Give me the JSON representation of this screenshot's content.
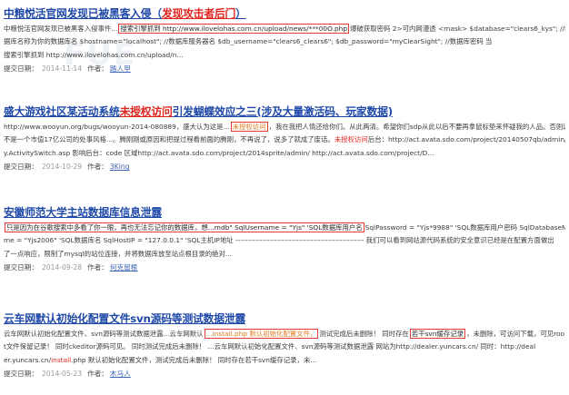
{
  "entries": [
    {
      "title": [
        {
          "t": "中粮悦活官网发现已被黑客入侵（",
          "c": ""
        },
        {
          "t": "发现攻击者后门",
          "c": "hl"
        },
        {
          "t": "）",
          "c": ""
        }
      ],
      "lines": [
        [
          {
            "t": "中粮悦活官网发现已被黑客入侵事件...",
            "c": ""
          },
          {
            "t": "搜索引擎抓到 http://www.ilovelohas.com.cn/upload/news/***00O.php",
            "c": "box"
          },
          {
            "t": "爆破获取密码 2>可内网漫透 <mask> $database=\"clears6_kys\"; //给改上面的数",
            "c": ""
          }
        ],
        [
          {
            "t": "据库名称为你的数据库名 $hostname=\"localhost\"; //数据库服务器名 $db_username=\"clears6_clears6\"; $db_password=\"myClearSight\"; //数据库密码 当",
            "c": ""
          }
        ],
        [
          {
            "t": "搜索引擎抓到 http://www.ilovelohas.com.cn/upload/n...",
            "c": ""
          }
        ]
      ],
      "meta_label": "提交日期：",
      "date": "2014-11-14",
      "author_label": "作者：",
      "author": "路人甲"
    },
    {
      "title": [
        {
          "t": "盛大游戏社区某活动系统",
          "c": ""
        },
        {
          "t": "未授权访问",
          "c": "hl"
        },
        {
          "t": "引发蝴蝶效应之三(涉及大量激活码、玩家数据)",
          "c": ""
        }
      ],
      "lines": [
        [
          {
            "t": "http://www.wooyun.org/bugs/wooyun-2014-080889，盛大认为这是...",
            "c": ""
          },
          {
            "t": "未授权访问",
            "c": "box orange"
          },
          {
            "t": "，我在我把人情还给你们。从此两清。希望你们sdp从此以后不要再拿鼠标垫来怀疑我的人品。否则这",
            "c": ""
          }
        ],
        [
          {
            "t": "不是一个市值17亿公司的处事风格...。腾刚刚或原因和把提过程看前面的腾刚，不再说了，说多了就成了废话。",
            "c": ""
          },
          {
            "t": "未授权访问",
            "c": "red"
          },
          {
            "t": "后台：http://act.avata.sdo.com/project/20140507qb/admin/Unit",
            "c": ""
          }
        ],
        [
          {
            "t": "y.ActivitySwitch.asp 影响后台：code 区域http://act.avata.sdo.com/project/2014sprite/admin/ http://act.avata.sdo.com/project/D...",
            "c": ""
          }
        ]
      ],
      "meta_label": "提交日期：",
      "date": "2014-10-29",
      "author_label": "作者：",
      "author": "3King"
    },
    {
      "title": [
        {
          "t": "安徽师范大学主站数据库信息泄露",
          "c": ""
        }
      ],
      "lines": [
        [
          {
            "t": "只是因为在谷歌搜索中多看了你一眼，再也无法忘记你的数据库，想...mdb\" SqlUsername = \"Yjs\" 'SQL数据库用户名",
            "c": "box"
          },
          {
            "t": "SqlPassword = \"Yjs*9988\" 'SQL数据库用户密码 SqlDatabaseNa",
            "c": ""
          }
        ],
        [
          {
            "t": "me = \"Yjs2006\" 'SQL数据库名 SqlHostIP = \"127.0.0.1\" 'SQL主机IP地址 ----------------------------------------------------- 我们可以看到网站源代码系统的安全意识已经是在配置方面做出",
            "c": ""
          }
        ],
        [
          {
            "t": "了一点响应，限制了mysql的站位连接，并将数据库放至站点根目录的绝对...",
            "c": ""
          }
        ]
      ],
      "meta_label": "提交日期：",
      "date": "2014-09-28",
      "author_label": "作者：",
      "author": "何克留根"
    },
    {
      "title": [
        {
          "t": "云车网默认初始化配置文件svn源码等测试数据泄露",
          "c": ""
        }
      ],
      "lines": [
        [
          {
            "t": "云车网默认初始化配置文件、svn源码等测试数据泄露...云车网默认",
            "c": ""
          },
          {
            "t": "...install.php 默认初始化配置文件，",
            "c": "box orange"
          },
          {
            "t": "测试完成后未删除！ 同时存在",
            "c": ""
          },
          {
            "t": "若干svn缓存记录",
            "c": "box"
          },
          {
            "t": "，未删除，可访问下载，可见roo",
            "c": ""
          }
        ],
        [
          {
            "t": "t文件保留记录！ 同时ckeditor源码可见。 同时测试完成后未删除！ ...云车网默认初始化配置文件、svn源码等测试数据泄露 网站为http://dealer.yuncars.cn/ 同时：http://deal",
            "c": ""
          }
        ],
        [
          {
            "t": "er.yuncars.cn/",
            "c": ""
          },
          {
            "t": "install",
            "c": "red"
          },
          {
            "t": ".php 默认初始化配置文件，测试完成后未删除！ 同时存在若干svn缓存记录，未...",
            "c": ""
          }
        ]
      ],
      "meta_label": "提交日期：",
      "date": "2014-05-23",
      "author_label": "作者：",
      "author": "木马人"
    }
  ]
}
